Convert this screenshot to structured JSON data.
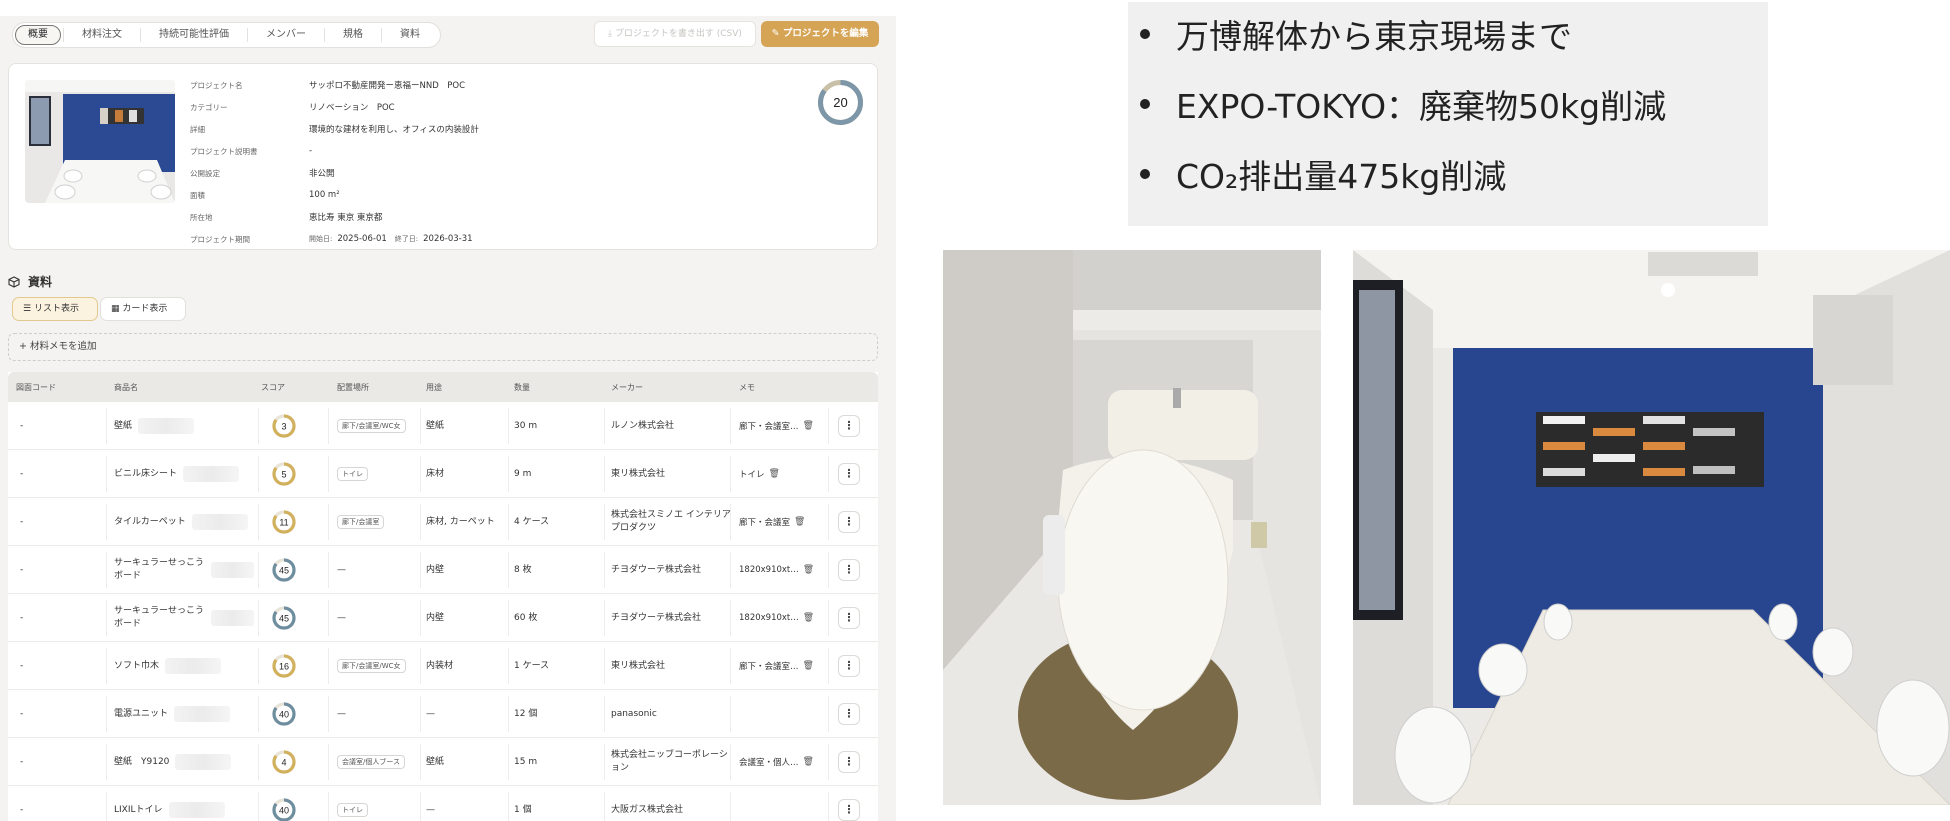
{
  "tabs": [
    "概要",
    "材料注文",
    "持続可能性評価",
    "メンバー",
    "規格",
    "資料"
  ],
  "toolbar": {
    "export_label": "⤓  プロジェクトを書き出す (CSV)",
    "edit_label": "✎  プロジェクトを編集"
  },
  "project": {
    "fields": [
      {
        "key": "プロジェクト名",
        "value": "サッポロ不動産開発ー恵福ーNND　POC"
      },
      {
        "key": "カテゴリー",
        "value": "リノベーション　POC"
      },
      {
        "key": "詳細",
        "value": "環境的な建材を利用し、オフィスの内装設計"
      },
      {
        "key": "プロジェクト説明書",
        "value": "-"
      },
      {
        "key": "公開設定",
        "value": "非公開"
      },
      {
        "key": "面積",
        "value": "100 m²"
      },
      {
        "key": "所在地",
        "value": "恵比寿 東京 東京都"
      }
    ],
    "period_key": "プロジェクト期間",
    "start_label": "開始日:",
    "start_date": "2025-06-01",
    "end_label": "終了日:",
    "end_date": "2026-03-31",
    "score": "20",
    "score_fraction": 0.2
  },
  "section": {
    "title": "資料",
    "list_view": "リスト表示",
    "card_view": "カード表示",
    "add_memo": "+  材料メモを追加"
  },
  "table": {
    "headers": [
      "図面コード",
      "商品名",
      "スコア",
      "配置場所",
      "用途",
      "数量",
      "メーカー",
      "メモ"
    ],
    "rows": [
      {
        "code": "-",
        "name": "壁紙",
        "score": "3",
        "place": "廊下/会議室/WC女",
        "use": "壁紙",
        "qty": "30 m",
        "maker": "ルノン株式会社",
        "memo": "廊下・会議室…"
      },
      {
        "code": "-",
        "name": "ビニル床シート",
        "score": "5",
        "place": "トイレ",
        "use": "床材",
        "qty": "9 m",
        "maker": "東リ株式会社",
        "memo": "トイレ"
      },
      {
        "code": "-",
        "name": "タイルカーペット",
        "score": "11",
        "place": "廊下/会議室",
        "use": "床材, カーペット",
        "qty": "4 ケース",
        "maker": "株式会社スミノエ インテリア プロダクツ",
        "memo": "廊下・会議室"
      },
      {
        "code": "-",
        "name": "サーキュラーせっこうボード",
        "score": "45",
        "place": "—",
        "use": "内壁",
        "qty": "8 枚",
        "maker": "チヨダウーテ株式会社",
        "memo": "1820x910xt…"
      },
      {
        "code": "-",
        "name": "サーキュラーせっこうボード",
        "score": "45",
        "place": "—",
        "use": "内壁",
        "qty": "60 枚",
        "maker": "チヨダウーテ株式会社",
        "memo": "1820x910xt…"
      },
      {
        "code": "-",
        "name": "ソフト巾木",
        "score": "16",
        "place": "廊下/会議室/WC女",
        "use": "内装材",
        "qty": "1 ケース",
        "maker": "東リ株式会社",
        "memo": "廊下・会議室…"
      },
      {
        "code": "-",
        "name": "電源ユニット",
        "score": "40",
        "place": "—",
        "use": "—",
        "qty": "12 個",
        "maker": "panasonic",
        "memo": ""
      },
      {
        "code": "-",
        "name": "壁紙　Y9120",
        "score": "4",
        "place": "会議室/個人ブース",
        "use": "壁紙",
        "qty": "15 m",
        "maker": "株式会社ニッブコーポレーション",
        "memo": "会議室・個人…"
      },
      {
        "code": "-",
        "name": "LIXILトイレ",
        "score": "40",
        "place": "トイレ",
        "use": "—",
        "qty": "1 個",
        "maker": "大阪ガス株式会社",
        "memo": ""
      }
    ]
  },
  "slide": {
    "bullets": [
      "万博解体から東京現場まで",
      "EXPO-TOKYO：廃棄物50kg削減",
      "CO₂排出量475kg削減"
    ]
  },
  "colors": {
    "accent": "#d6a455",
    "score_high": "#6e8ea0",
    "score_low": "#d2b15e",
    "wall_blue": "#27468f"
  }
}
